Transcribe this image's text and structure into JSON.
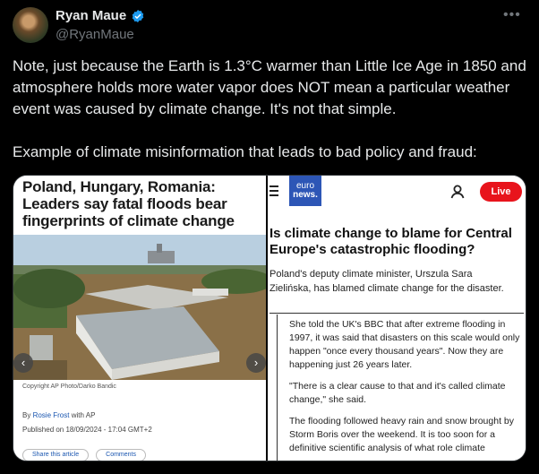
{
  "author": {
    "name": "Ryan Maue",
    "handle": "@RyanMaue"
  },
  "tweet": {
    "paragraph1": "Note, just because the Earth is 1.3°C warmer than Little Ice Age in 1850 and atmosphere holds more water vapor does NOT mean a particular weather event was caused by climate change.  It's not that simple.",
    "paragraph2": "Example of climate misinformation that leads to bad policy and fraud:"
  },
  "left_article": {
    "headline": "Poland, Hungary, Romania: Leaders say fatal floods bear fingerprints of climate change",
    "caption": "Copyright AP Photo/Darko Bandic",
    "byline_prefix": "By",
    "author": "Rosie Frost",
    "byline_with": "with AP",
    "published": "Published on 18/09/2024 - 17:04 GMT+2",
    "share_label": "Share this article",
    "comments_label": "Comments"
  },
  "right_article": {
    "logo_line1": "euro",
    "logo_line2": "news.",
    "live_label": "Live",
    "headline": "Is climate change to blame for Central Europe's catastrophic flooding?",
    "lead": "Poland's deputy climate minister, Urszula Sara Zielińska, has blamed climate change for the disaster.",
    "body": [
      "She told the UK's BBC that after extreme flooding in 1997, it was said that disasters on this scale would only happen \"once every thousand years\". Now they are happening just 26 years later.",
      "\"There is a clear cause to that and it's called climate change,\" she said.",
      "The flooding followed heavy rain and snow brought by Storm Boris over the weekend. It is too soon for a definitive scientific analysis of what role climate"
    ]
  },
  "icons": [
    "verified-badge-icon",
    "more-options-icon",
    "hamburger-menu-icon",
    "user-icon",
    "chevron-left-icon",
    "chevron-right-icon"
  ],
  "colors": {
    "background": "#000000",
    "verified": "#1d9bf0",
    "euronews_blue": "#2d56b6",
    "live_red": "#e8141c"
  }
}
